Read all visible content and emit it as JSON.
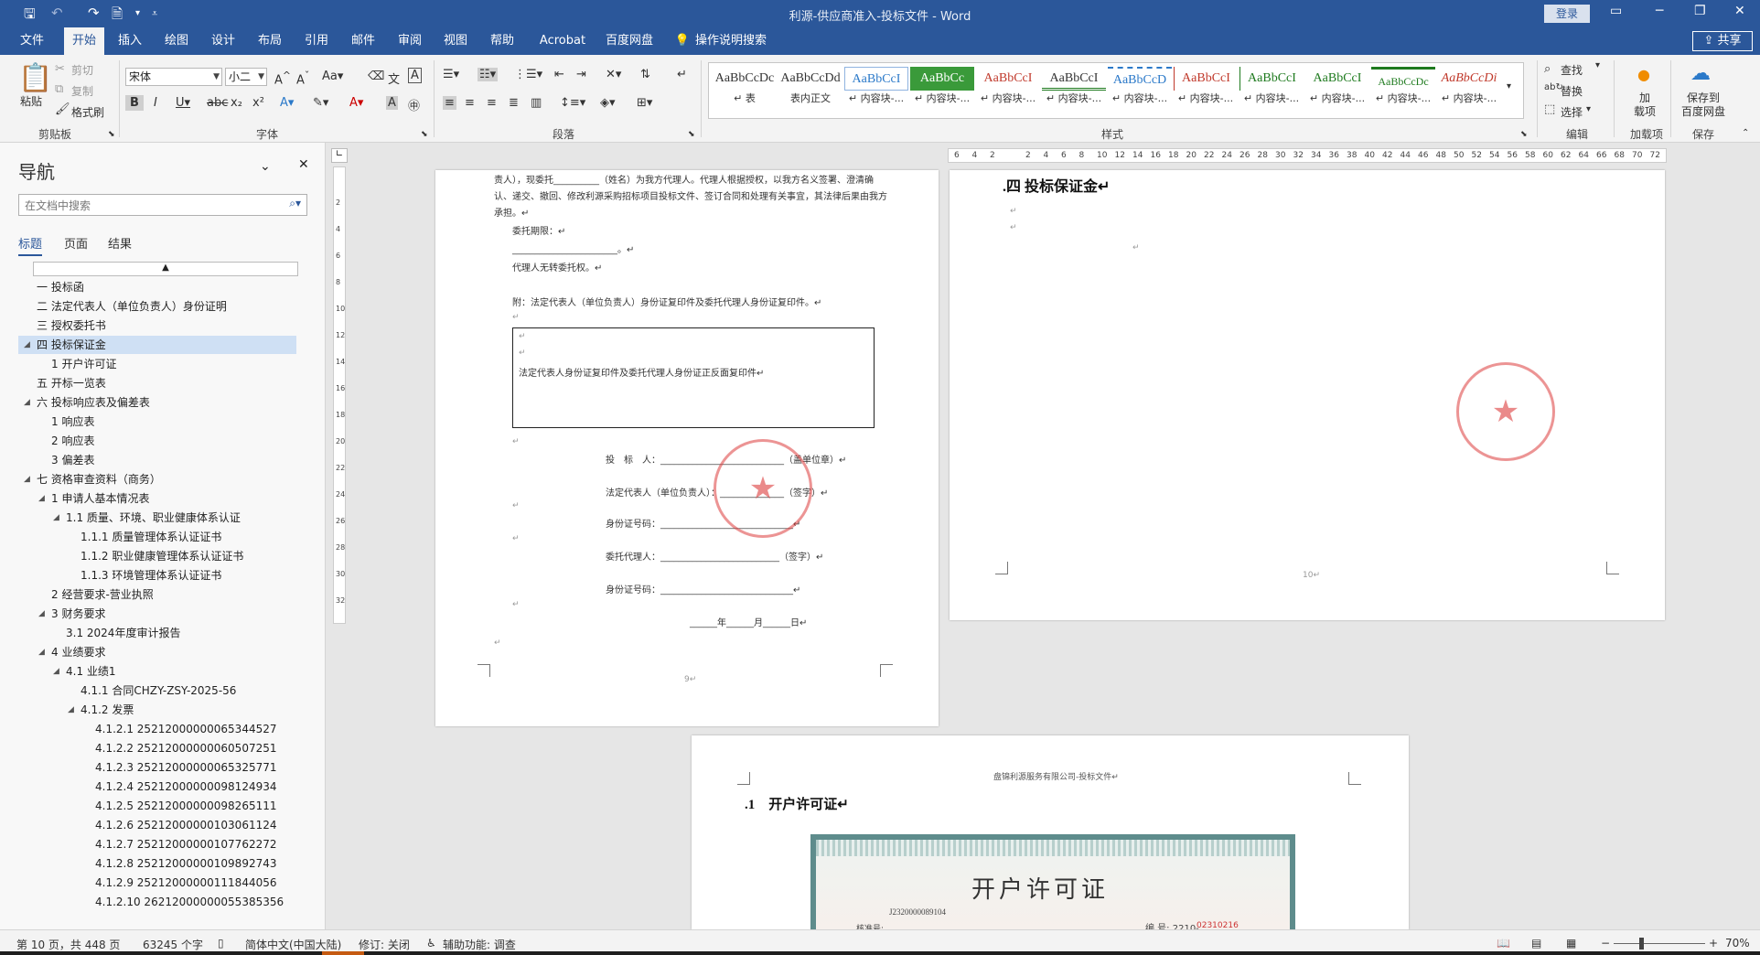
{
  "app": {
    "doc_title": "利源-供应商准入-投标文件  -  Word",
    "login": "登录",
    "share": "共享"
  },
  "tabs": [
    "文件",
    "开始",
    "插入",
    "绘图",
    "设计",
    "布局",
    "引用",
    "邮件",
    "审阅",
    "视图",
    "帮助",
    "Acrobat",
    "百度网盘",
    "操作说明搜索"
  ],
  "ribbon": {
    "clipboard": {
      "paste": "粘贴",
      "cut": "剪切",
      "copy": "复制",
      "format_painter": "格式刷",
      "label": "剪贴板"
    },
    "font": {
      "name": "宋体",
      "size": "小二",
      "label": "字体"
    },
    "paragraph": {
      "label": "段落"
    },
    "styles": {
      "label": "样式",
      "items": [
        {
          "preview": "AaBbCcDc",
          "name": "↵ 表"
        },
        {
          "preview": "AaBbCcDd",
          "name": "表内正文"
        },
        {
          "preview": "AaBbCcI",
          "name": "↵ 内容块-..."
        },
        {
          "preview": "AaBbCc",
          "name": "↵ 内容块-..."
        },
        {
          "preview": "AaBbCcI",
          "name": "↵ 内容块-..."
        },
        {
          "preview": "AaBbCcI",
          "name": "↵ 内容块-..."
        },
        {
          "preview": "AaBbCcD",
          "name": "↵ 内容块-..."
        },
        {
          "preview": "AaBbCcI",
          "name": "↵ 内容块-..."
        },
        {
          "preview": "AaBbCcI",
          "name": "↵ 内容块-..."
        },
        {
          "preview": "AaBbCcI",
          "name": "↵ 内容块-..."
        },
        {
          "preview": "AaBbCcDc",
          "name": "↵ 内容块-..."
        },
        {
          "preview": "AaBbCcDi",
          "name": "↵ 内容块-..."
        }
      ]
    },
    "editing": {
      "find": "查找",
      "replace": "替换",
      "select": "选择",
      "label": "编辑"
    },
    "addins": {
      "button": "加\n载项",
      "label": "加载项"
    },
    "save": {
      "button": "保存到\n百度网盘",
      "label": "保存"
    }
  },
  "nav": {
    "title": "导航",
    "search_placeholder": "在文档中搜索",
    "tabs": [
      "标题",
      "页面",
      "结果"
    ],
    "items": [
      {
        "text": "一 投标函",
        "level": 1,
        "tri": ""
      },
      {
        "text": "二 法定代表人（单位负责人）身份证明",
        "level": 1,
        "tri": ""
      },
      {
        "text": "三 授权委托书",
        "level": 1,
        "tri": ""
      },
      {
        "text": "四 投标保证金",
        "level": 1,
        "tri": "◢",
        "selected": true
      },
      {
        "text": "1 开户许可证",
        "level": 2,
        "tri": ""
      },
      {
        "text": "五 开标一览表",
        "level": 1,
        "tri": ""
      },
      {
        "text": "六 投标响应表及偏差表",
        "level": 1,
        "tri": "◢"
      },
      {
        "text": "1 响应表",
        "level": 2,
        "tri": ""
      },
      {
        "text": "2 响应表",
        "level": 2,
        "tri": ""
      },
      {
        "text": "3 偏差表",
        "level": 2,
        "tri": ""
      },
      {
        "text": "七 资格审查资料（商务）",
        "level": 1,
        "tri": "◢"
      },
      {
        "text": "1 申请人基本情况表",
        "level": 2,
        "tri": "◢"
      },
      {
        "text": "1.1 质量、环境、职业健康体系认证",
        "level": 3,
        "tri": "◢"
      },
      {
        "text": "1.1.1 质量管理体系认证证书",
        "level": 4,
        "tri": ""
      },
      {
        "text": "1.1.2 职业健康管理体系认证证书",
        "level": 4,
        "tri": ""
      },
      {
        "text": "1.1.3 环境管理体系认证证书",
        "level": 4,
        "tri": ""
      },
      {
        "text": "2 经营要求-营业执照",
        "level": 2,
        "tri": ""
      },
      {
        "text": "3 财务要求",
        "level": 2,
        "tri": "◢"
      },
      {
        "text": "3.1 2024年度审计报告",
        "level": 3,
        "tri": ""
      },
      {
        "text": "4 业绩要求",
        "level": 2,
        "tri": "◢"
      },
      {
        "text": "4.1 业绩1",
        "level": 3,
        "tri": "◢"
      },
      {
        "text": "4.1.1 合同CHZY-ZSY-2025-56",
        "level": 4,
        "tri": ""
      },
      {
        "text": "4.1.2 发票",
        "level": 4,
        "tri": "◢"
      },
      {
        "text": "4.1.2.1 25212000000065344527",
        "level": 5,
        "tri": ""
      },
      {
        "text": "4.1.2.2 25212000000060507251",
        "level": 5,
        "tri": ""
      },
      {
        "text": "4.1.2.3 25212000000065325771",
        "level": 5,
        "tri": ""
      },
      {
        "text": "4.1.2.4 25212000000098124934",
        "level": 5,
        "tri": ""
      },
      {
        "text": "4.1.2.5 25212000000098265111",
        "level": 5,
        "tri": ""
      },
      {
        "text": "4.1.2.6 25212000000103061124",
        "level": 5,
        "tri": ""
      },
      {
        "text": "4.1.2.7 25212000000107762272",
        "level": 5,
        "tri": ""
      },
      {
        "text": "4.1.2.8 25212000000109892743",
        "level": 5,
        "tri": ""
      },
      {
        "text": "4.1.2.9 25212000000111844056",
        "level": 5,
        "tri": ""
      },
      {
        "text": "4.1.2.10 26212000000055385356",
        "level": 5,
        "tri": ""
      }
    ]
  },
  "page9": {
    "lines": [
      "责人），现委托__________（姓名）为我方代理人。代理人根据授权，以我方名义签署、澄清确",
      "认、递交、撤回、修改利源采购招标项目投标文件、签订合同和处理有关事宜，其法律后果由我方",
      "承担。↵"
    ],
    "l_term": "委托期限：↵",
    "l_blank": "_______________________。↵",
    "l_norights": "代理人无转委托权。↵",
    "l_attach": "附：法定代表人（单位负责人）身份证复印件及委托代理人身份证复印件。↵",
    "box_text": "法定代表人身份证复印件及委托代理人身份证正反面复印件↵",
    "sig": [
      "投　标　人：___________________________（盖单位章）↵",
      "法定代表人（单位负责人）：______________（签字）↵",
      "身份证号码：_____________________________↵",
      "委托代理人：__________________________（签字）↵",
      "身份证号码：_____________________________↵"
    ],
    "date": "______年______月______日↵",
    "page_no": "9↵"
  },
  "page10": {
    "heading": ".四 投标保证金↵",
    "page_no": "10↵"
  },
  "page11": {
    "header": "盘锦利源服务有限公司-投标文件↵",
    "heading": ".1　开户许可证↵",
    "cert_title": "开户许可证",
    "cert_no_label": "核准号:",
    "cert_no": "J2320000089104",
    "cert_serial_label": "编 号: 2210-",
    "cert_serial": "02310216"
  },
  "hruler": [
    "6",
    "4",
    "2",
    "",
    "2",
    "4",
    "6",
    "8",
    "10",
    "12",
    "14",
    "16",
    "18",
    "20",
    "22",
    "24",
    "26",
    "28",
    "30",
    "32",
    "34",
    "36",
    "38",
    "40",
    "42",
    "44",
    "46",
    "48",
    "50",
    "52",
    "54",
    "56",
    "58",
    "60",
    "62",
    "64",
    "66",
    "68",
    "70",
    "72"
  ],
  "vruler": [
    "2",
    "4",
    "6",
    "8",
    "10",
    "12",
    "14",
    "16",
    "18",
    "20",
    "22",
    "24",
    "26",
    "28",
    "30",
    "32"
  ],
  "status": {
    "page": "第 10 页，共 448 页",
    "words": "63245 个字",
    "lang": "简体中文(中国大陆)",
    "track": "修订: 关闭",
    "access": "辅助功能: 调查",
    "zoom": "70%"
  },
  "colors": {
    "accent": "#2b579a",
    "seal": "#dc3c3c"
  }
}
